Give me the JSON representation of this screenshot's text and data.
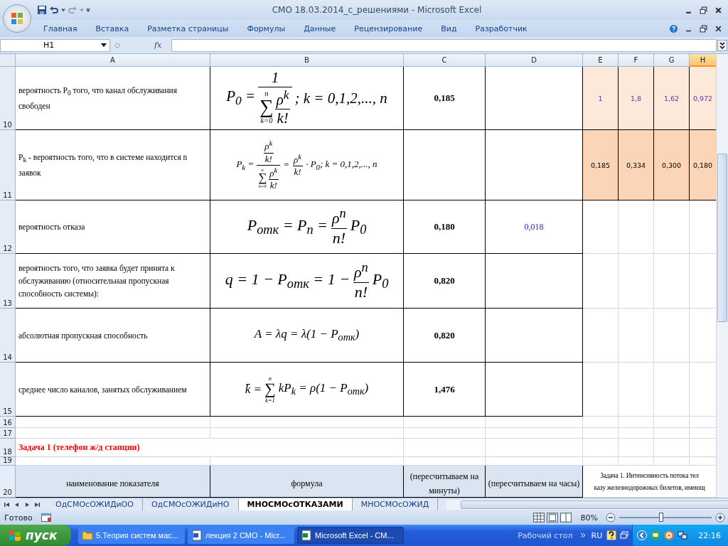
{
  "window": {
    "title": "СМО 18.03.2014_с_решениями - Microsoft Excel"
  },
  "ribbon_tabs": [
    "Главная",
    "Вставка",
    "Разметка страницы",
    "Формулы",
    "Данные",
    "Рецензирование",
    "Вид",
    "Разработчик"
  ],
  "formula_bar": {
    "name_box": "H1",
    "function_button": "fx"
  },
  "columns": [
    {
      "label": "A",
      "selected": false
    },
    {
      "label": "B",
      "selected": false
    },
    {
      "label": "C",
      "selected": false
    },
    {
      "label": "D",
      "selected": false
    },
    {
      "label": "E",
      "selected": false
    },
    {
      "label": "F",
      "selected": false
    },
    {
      "label": "G",
      "selected": false
    },
    {
      "label": "H",
      "selected": true
    }
  ],
  "rows": [
    {
      "number": "10",
      "cells": [
        {
          "kind": "label",
          "text": "вероятность P$_{0}$ того, что канал обслуживания свободен"
        },
        {
          "kind": "formula",
          "tokens": [
            {
              "kind": "text",
              "text": "P$_{0}$ ="
            },
            {
              "kind": "frac",
              "num": [
                {
                  "kind": "text",
                  "text": "1"
                }
              ],
              "den": [
                {
                  "kind": "sum",
                  "sign": "∑",
                  "top": "n",
                  "bottom": "k=0"
                },
                {
                  "kind": "frac",
                  "num": [
                    {
                      "kind": "text",
                      "text": "ρ$^{k}$"
                    }
                  ],
                  "den": [
                    {
                      "kind": "text",
                      "text": "k!"
                    }
                  ]
                }
              ]
            },
            {
              "kind": "text",
              "text": "; k = 0,1,2,..., n"
            }
          ]
        },
        {
          "kind": "result",
          "text": "0,185"
        },
        {
          "kind": "box"
        },
        {
          "kind": "param",
          "text": "1"
        },
        {
          "kind": "param",
          "text": "1,8"
        },
        {
          "kind": "param",
          "text": "1,62"
        },
        {
          "kind": "param",
          "text": "0,972"
        }
      ]
    },
    {
      "number": "11",
      "cells": [
        {
          "kind": "label",
          "text": "P$_{k}$  - вероятность того, что в системе находится n заявок"
        },
        {
          "kind": "formula",
          "tokens": [
            {
              "kind": "text",
              "text": "P$_{k}$ ="
            },
            {
              "kind": "frac",
              "num": [
                {
                  "kind": "frac",
                  "num": [
                    {
                      "kind": "text",
                      "text": "ρ$^{k}$"
                    }
                  ],
                  "den": [
                    {
                      "kind": "text",
                      "text": "k!"
                    }
                  ]
                }
              ],
              "den": [
                {
                  "kind": "sum",
                  "sign": "∑",
                  "top": "n",
                  "bottom": "k=0"
                },
                {
                  "kind": "frac",
                  "num": [
                    {
                      "kind": "text",
                      "text": "ρ$^{k}$"
                    }
                  ],
                  "den": [
                    {
                      "kind": "text",
                      "text": "k!"
                    }
                  ]
                }
              ]
            },
            {
              "kind": "text",
              "text": "="
            },
            {
              "kind": "frac",
              "num": [
                {
                  "kind": "text",
                  "text": "ρ$^{k}$"
                }
              ],
              "den": [
                {
                  "kind": "text",
                  "text": "k!"
                }
              ]
            },
            {
              "kind": "text",
              "text": "· P$_{0}$; k = 0,1,2,..., n"
            }
          ]
        },
        {
          "kind": "box"
        },
        {
          "kind": "box"
        },
        {
          "kind": "prob",
          "text": "0,185"
        },
        {
          "kind": "prob",
          "text": "0,334"
        },
        {
          "kind": "prob",
          "text": "0,300"
        },
        {
          "kind": "prob",
          "text": "0,180"
        }
      ]
    },
    {
      "number": "12",
      "cells": [
        {
          "kind": "label",
          "text": "вероятность отказа"
        },
        {
          "kind": "formula",
          "tokens": [
            {
              "kind": "text",
              "text": "P$_{отк}$ = P$_{n}$ ="
            },
            {
              "kind": "frac",
              "num": [
                {
                  "kind": "text",
                  "text": "ρ$^{n}$"
                }
              ],
              "den": [
                {
                  "kind": "text",
                  "text": "n!"
                }
              ]
            },
            {
              "kind": "text",
              "text": "P$_{0}$"
            }
          ]
        },
        {
          "kind": "result",
          "text": "0,180"
        },
        {
          "kind": "link",
          "text": "0,018"
        },
        {
          "kind": "blank"
        },
        {
          "kind": "blank"
        },
        {
          "kind": "blank"
        },
        {
          "kind": "blank"
        }
      ]
    },
    {
      "number": "13",
      "cells": [
        {
          "kind": "label",
          "text": "вероятность того, что заявка будет принята к обслуживанию (относительная пропускная способность системы):"
        },
        {
          "kind": "formula",
          "tokens": [
            {
              "kind": "text",
              "text": "q = 1 − P$_{отк}$ = 1 −"
            },
            {
              "kind": "frac",
              "num": [
                {
                  "kind": "text",
                  "text": "ρ$^{n}$"
                }
              ],
              "den": [
                {
                  "kind": "text",
                  "text": "n!"
                }
              ]
            },
            {
              "kind": "text",
              "text": "P$_{0}$"
            }
          ]
        },
        {
          "kind": "result",
          "text": "0,820"
        },
        {
          "kind": "box"
        },
        {
          "kind": "blank"
        },
        {
          "kind": "blank"
        },
        {
          "kind": "blank"
        },
        {
          "kind": "blank"
        }
      ]
    },
    {
      "number": "14",
      "cells": [
        {
          "kind": "label",
          "text": "абсолютная пропускная способность"
        },
        {
          "kind": "formula",
          "tokens": [
            {
              "kind": "text",
              "text": "A = λq = λ(1 − P$_{отк}$)"
            }
          ]
        },
        {
          "kind": "result",
          "text": "0,820"
        },
        {
          "kind": "box"
        },
        {
          "kind": "blank"
        },
        {
          "kind": "blank"
        },
        {
          "kind": "blank"
        },
        {
          "kind": "blank"
        }
      ]
    },
    {
      "number": "15",
      "cells": [
        {
          "kind": "label",
          "text": "среднее число каналов, занятых обслуживанием"
        },
        {
          "kind": "formula",
          "tokens": [
            {
              "kind": "text",
              "text": "k̄ ="
            },
            {
              "kind": "sum",
              "sign": "∑",
              "top": "n",
              "bottom": "k=1"
            },
            {
              "kind": "text",
              "text": "kP$_{k}$ = ρ(1 − P$_{отк}$)"
            }
          ]
        },
        {
          "kind": "result",
          "text": "1,476"
        },
        {
          "kind": "box"
        },
        {
          "kind": "blank"
        },
        {
          "kind": "blank"
        },
        {
          "kind": "blank"
        },
        {
          "kind": "blank"
        }
      ]
    },
    {
      "number": "16",
      "cells": []
    },
    {
      "number": "17",
      "cells": []
    },
    {
      "number": "18",
      "cells": [
        {
          "kind": "heading",
          "text": "Задача 1 (телефон ж/д станции)"
        }
      ]
    },
    {
      "number": "19",
      "cells": []
    },
    {
      "number": "20",
      "cells": [
        {
          "kind": "header",
          "text": "наименование показателя"
        },
        {
          "kind": "header",
          "text": "формула"
        },
        {
          "kind": "header",
          "text": "(пересчитываем на минуты)"
        },
        {
          "kind": "header",
          "text": "(пересчитываем на часы)"
        },
        {
          "kind": "note",
          "lines": [
            "Задача 1. Интенсивность потока тел",
            "казу железнодорожных билетов, имеющ"
          ]
        }
      ]
    }
  ],
  "sheet_tabs": [
    {
      "label": "ОдСМОсОЖИДиОО",
      "selected": false
    },
    {
      "label": "ОдСМОсОЖИДиНО",
      "selected": false
    },
    {
      "label": "МНОСМОсОТКАЗАМИ",
      "selected": true
    },
    {
      "label": "МНОСМОсОЖИД",
      "selected": false
    }
  ],
  "status_bar": {
    "text": "Готово",
    "zoom": "80%",
    "zoom_slider": {
      "level": 0.45
    }
  },
  "taskbar": {
    "start": "пуск",
    "tasks": [
      {
        "label": "5.Теория систем мас...",
        "selected": false
      },
      {
        "label": "лекция 2 СМО - Micr...",
        "selected": false
      },
      {
        "label": "Microsoft Excel - СМ...",
        "selected": true
      }
    ],
    "desktop": "Рабочий стол",
    "language": "RU",
    "clock": "22:16"
  }
}
